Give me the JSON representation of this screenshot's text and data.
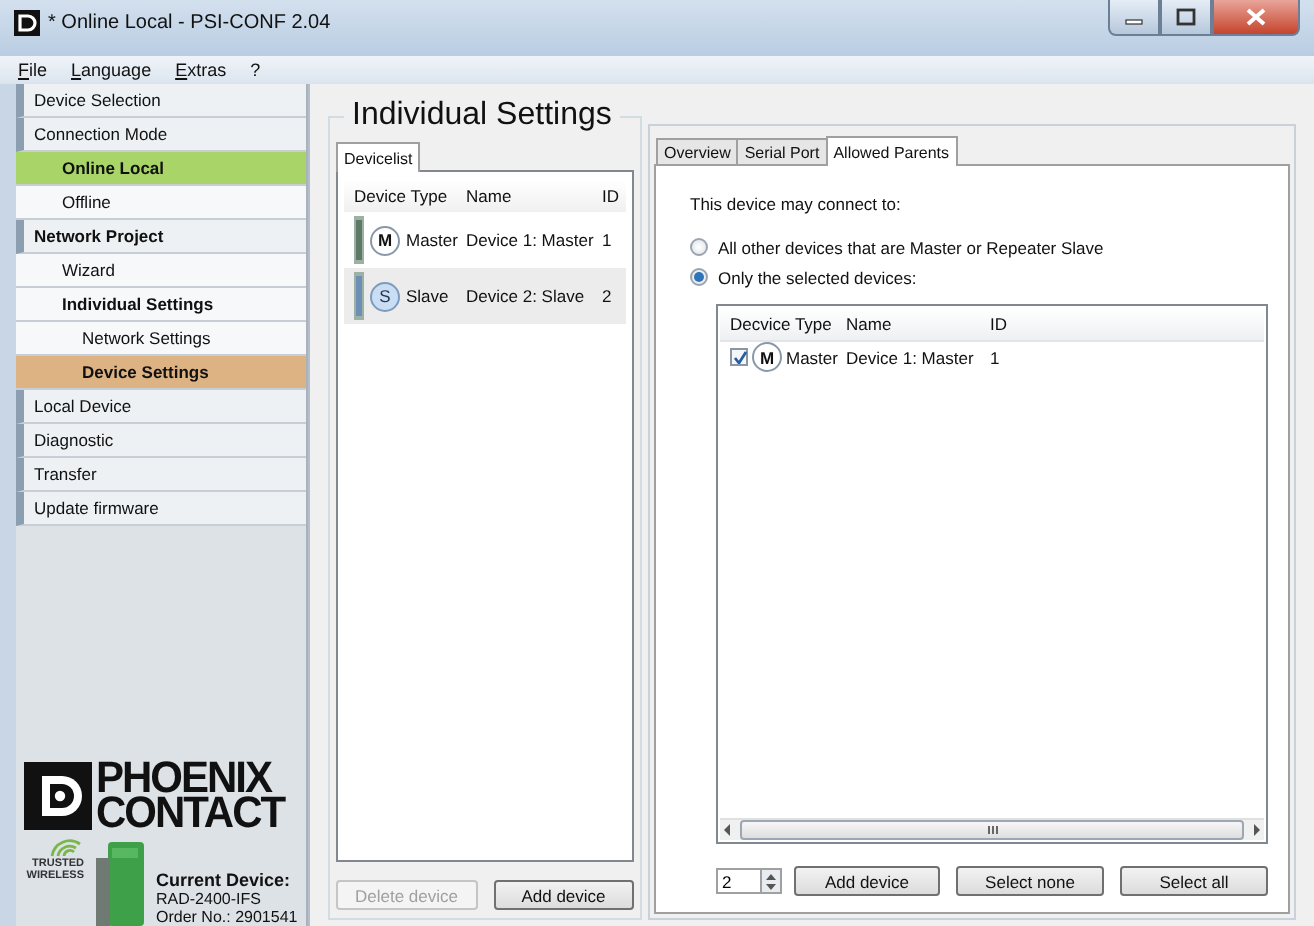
{
  "window": {
    "title": "* Online Local - PSI-CONF 2.04"
  },
  "menu": [
    "File",
    "Language",
    "Extras",
    "?"
  ],
  "sidebar": {
    "items": [
      {
        "label": "Device Selection",
        "selected": false,
        "active": false
      },
      {
        "label": "Connection Mode",
        "selected": false,
        "active": false,
        "children": [
          {
            "label": "Online Local",
            "selected": false,
            "active": true
          },
          {
            "label": "Offline",
            "selected": false,
            "active": false
          }
        ]
      },
      {
        "label": "Network Project",
        "selected": false,
        "active": false,
        "children": [
          {
            "label": "Wizard",
            "selected": false,
            "active": false
          },
          {
            "label": "Individual Settings",
            "selected": false,
            "active": false,
            "children": [
              {
                "label": "Network Settings",
                "selected": false,
                "active": false
              },
              {
                "label": "Device Settings",
                "selected": true,
                "active": false
              }
            ]
          }
        ]
      },
      {
        "label": "Local Device",
        "selected": false,
        "active": false
      },
      {
        "label": "Diagnostic",
        "selected": false,
        "active": false
      },
      {
        "label": "Transfer",
        "selected": false,
        "active": false
      },
      {
        "label": "Update firmware",
        "selected": false,
        "active": false
      }
    ]
  },
  "branding": {
    "logo_lines": [
      "PHOENIX",
      "CONTACT"
    ],
    "badge_lines": [
      "TRUSTED",
      "WIRELESS"
    ],
    "current_device": {
      "heading": "Current Device:",
      "model": "RAD-2400-IFS",
      "order": "Order No.: 2901541"
    }
  },
  "heading": "Individual Settings",
  "device_panel": {
    "tabs": [
      {
        "label": "Devicelist",
        "selected": true
      }
    ],
    "columns": [
      "Device Type",
      "Name",
      "ID"
    ],
    "rows": [
      {
        "kind": "master",
        "badge": "M",
        "type": "Master",
        "name": "Device 1: Master",
        "id": "1",
        "selected": false
      },
      {
        "kind": "slave",
        "badge": "S",
        "type": "Slave",
        "name": "Device 2: Slave",
        "id": "2",
        "selected": true
      }
    ],
    "buttons": [
      {
        "label": "Delete device",
        "disabled": true
      },
      {
        "label": "Add device",
        "disabled": false
      }
    ]
  },
  "settings_panel": {
    "tabs": [
      {
        "label": "Overview",
        "selected": false
      },
      {
        "label": "Serial Port",
        "selected": false
      },
      {
        "label": "Allowed Parents",
        "selected": true
      }
    ],
    "prompt": "This device may connect to:",
    "options": [
      {
        "label": "All other devices that are Master or Repeater Slave",
        "selected": false
      },
      {
        "label": "Only the selected devices:",
        "selected": true
      }
    ],
    "parents": {
      "columns": [
        "Decvice Type",
        "Name",
        "ID"
      ],
      "rows": [
        {
          "checked": true,
          "badge": "M",
          "type": "Master",
          "name": "Device 1: Master",
          "id": "1"
        }
      ]
    },
    "count": "2",
    "buttons": [
      {
        "label": "Add device"
      },
      {
        "label": "Select none"
      },
      {
        "label": "Select all"
      }
    ]
  }
}
